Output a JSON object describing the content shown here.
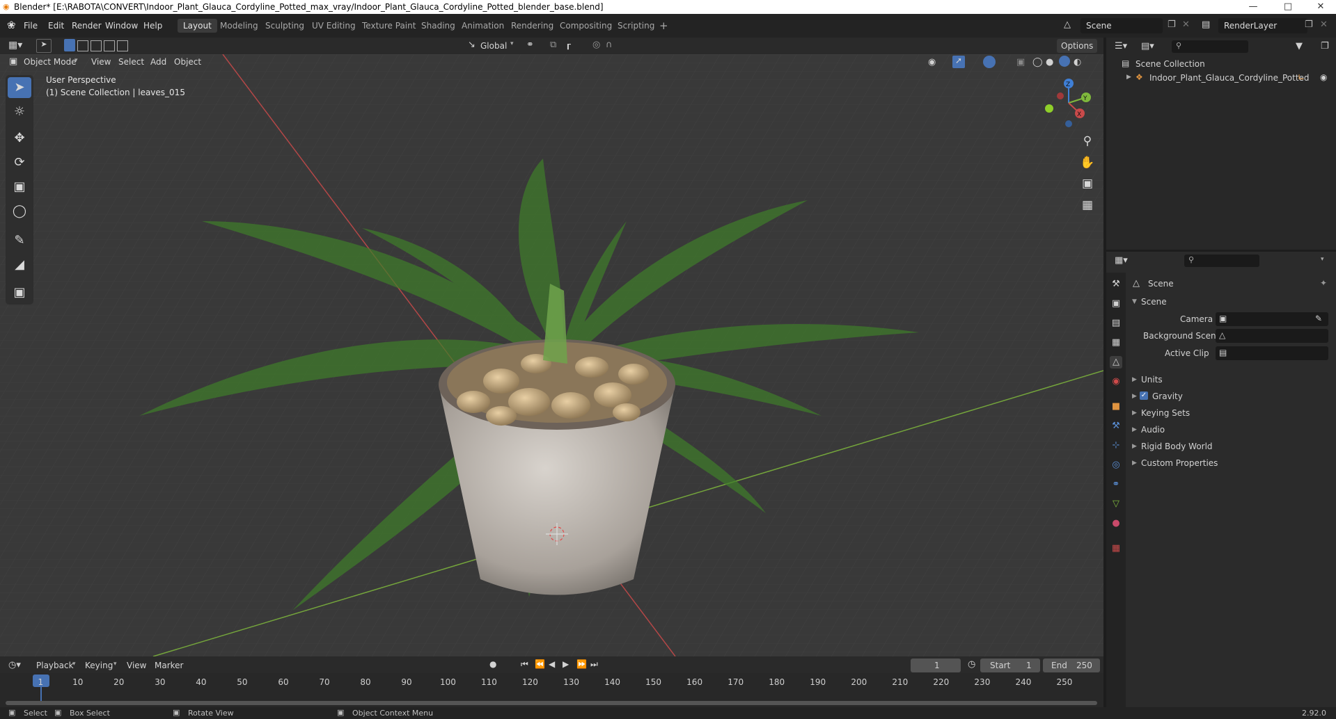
{
  "window": {
    "title": "Blender* [E:\\RABOTA\\CONVERT\\Indoor_Plant_Glauca_Cordyline_Potted_max_vray/Indoor_Plant_Glauca_Cordyline_Potted_blender_base.blend]",
    "minimize": "—",
    "maximize": "□",
    "close": "✕"
  },
  "menu": [
    "File",
    "Edit",
    "Render",
    "Window",
    "Help"
  ],
  "workspaces": [
    "Layout",
    "Modeling",
    "Sculpting",
    "UV Editing",
    "Texture Paint",
    "Shading",
    "Animation",
    "Rendering",
    "Compositing",
    "Scripting"
  ],
  "scene_field": "Scene",
  "render_layer_field": "RenderLayer",
  "header": {
    "mode": "Object Mode",
    "view": "View",
    "select": "Select",
    "add": "Add",
    "object": "Object",
    "transform": "Global",
    "options": "Options"
  },
  "viewport": {
    "perspective": "User Perspective",
    "collection_info": "(1) Scene Collection | leaves_015",
    "axes": {
      "x": "X",
      "y": "Y",
      "z": "Z"
    }
  },
  "outliner": {
    "root": "Scene Collection",
    "item": "Indoor_Plant_Glauca_Cordyline_Potted"
  },
  "properties": {
    "context": "Scene",
    "section": "Scene",
    "camera_label": "Camera",
    "background_label": "Background Scene",
    "clip_label": "Active Clip",
    "panels": [
      "Units",
      "Gravity",
      "Keying Sets",
      "Audio",
      "Rigid Body World",
      "Custom Properties"
    ],
    "gravity_checked": true
  },
  "timeline": {
    "playback": "Playback",
    "keying": "Keying",
    "view": "View",
    "marker": "Marker",
    "current_frame": "1",
    "start_label": "Start",
    "start": "1",
    "end_label": "End",
    "end": "250",
    "ticks": [
      "1",
      "10",
      "20",
      "30",
      "40",
      "50",
      "60",
      "70",
      "80",
      "90",
      "100",
      "110",
      "120",
      "130",
      "140",
      "150",
      "160",
      "170",
      "180",
      "190",
      "200",
      "210",
      "220",
      "230",
      "240",
      "250"
    ]
  },
  "status": {
    "select": "Select",
    "box_select": "Box Select",
    "rotate": "Rotate View",
    "context_menu": "Object Context Menu",
    "version": "2.92.0"
  },
  "colors": {
    "accent": "#4772b3",
    "axis_x": "#c94a4a",
    "axis_y": "#7fb83c",
    "axis_z": "#3f7fd6",
    "leaf": "#3f7e2a"
  }
}
